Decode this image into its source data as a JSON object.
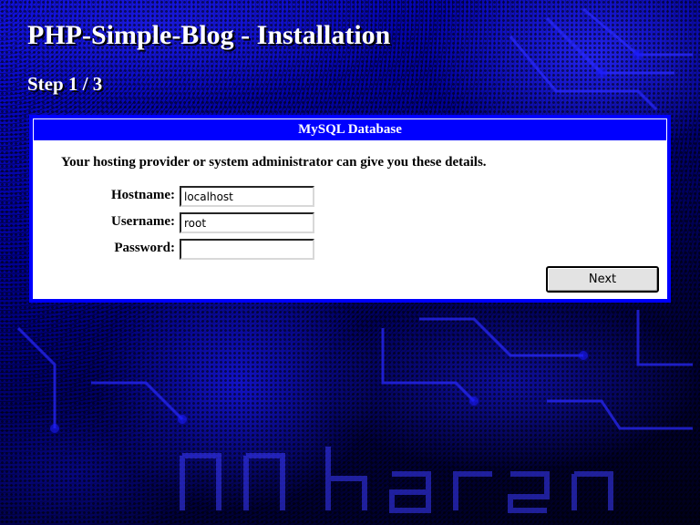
{
  "page": {
    "title": "PHP-Simple-Blog - Installation",
    "step": "Step 1 / 3"
  },
  "panel": {
    "header": "MySQL Database",
    "intro": "Your hosting provider or system administrator can give you these details.",
    "fields": {
      "hostname": {
        "label": "Hostname:",
        "value": "localhost"
      },
      "username": {
        "label": "Username:",
        "value": "root"
      },
      "password": {
        "label": "Password:",
        "value": ""
      }
    },
    "next_label": "Next"
  },
  "colors": {
    "panel_border": "#0000ff",
    "header_background": "#0000ff",
    "background_primary": "#0b0bd8",
    "background_dark": "#000018"
  }
}
